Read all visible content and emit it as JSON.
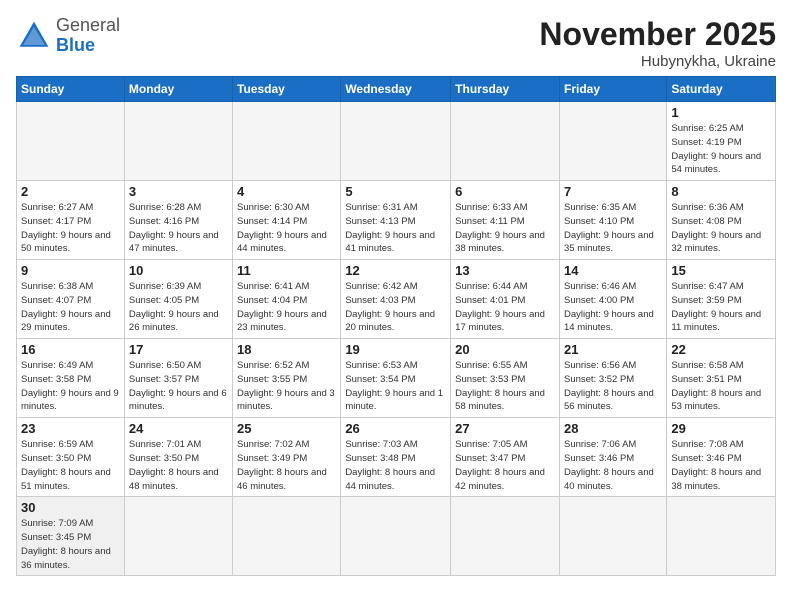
{
  "header": {
    "logo": {
      "general": "General",
      "blue": "Blue"
    },
    "title": "November 2025",
    "location": "Hubynykha, Ukraine"
  },
  "days_of_week": [
    "Sunday",
    "Monday",
    "Tuesday",
    "Wednesday",
    "Thursday",
    "Friday",
    "Saturday"
  ],
  "weeks": [
    [
      {
        "day": "",
        "info": ""
      },
      {
        "day": "",
        "info": ""
      },
      {
        "day": "",
        "info": ""
      },
      {
        "day": "",
        "info": ""
      },
      {
        "day": "",
        "info": ""
      },
      {
        "day": "",
        "info": ""
      },
      {
        "day": "1",
        "info": "Sunrise: 6:25 AM\nSunset: 4:19 PM\nDaylight: 9 hours\nand 54 minutes."
      }
    ],
    [
      {
        "day": "2",
        "info": "Sunrise: 6:27 AM\nSunset: 4:17 PM\nDaylight: 9 hours\nand 50 minutes."
      },
      {
        "day": "3",
        "info": "Sunrise: 6:28 AM\nSunset: 4:16 PM\nDaylight: 9 hours\nand 47 minutes."
      },
      {
        "day": "4",
        "info": "Sunrise: 6:30 AM\nSunset: 4:14 PM\nDaylight: 9 hours\nand 44 minutes."
      },
      {
        "day": "5",
        "info": "Sunrise: 6:31 AM\nSunset: 4:13 PM\nDaylight: 9 hours\nand 41 minutes."
      },
      {
        "day": "6",
        "info": "Sunrise: 6:33 AM\nSunset: 4:11 PM\nDaylight: 9 hours\nand 38 minutes."
      },
      {
        "day": "7",
        "info": "Sunrise: 6:35 AM\nSunset: 4:10 PM\nDaylight: 9 hours\nand 35 minutes."
      },
      {
        "day": "8",
        "info": "Sunrise: 6:36 AM\nSunset: 4:08 PM\nDaylight: 9 hours\nand 32 minutes."
      }
    ],
    [
      {
        "day": "9",
        "info": "Sunrise: 6:38 AM\nSunset: 4:07 PM\nDaylight: 9 hours\nand 29 minutes."
      },
      {
        "day": "10",
        "info": "Sunrise: 6:39 AM\nSunset: 4:05 PM\nDaylight: 9 hours\nand 26 minutes."
      },
      {
        "day": "11",
        "info": "Sunrise: 6:41 AM\nSunset: 4:04 PM\nDaylight: 9 hours\nand 23 minutes."
      },
      {
        "day": "12",
        "info": "Sunrise: 6:42 AM\nSunset: 4:03 PM\nDaylight: 9 hours\nand 20 minutes."
      },
      {
        "day": "13",
        "info": "Sunrise: 6:44 AM\nSunset: 4:01 PM\nDaylight: 9 hours\nand 17 minutes."
      },
      {
        "day": "14",
        "info": "Sunrise: 6:46 AM\nSunset: 4:00 PM\nDaylight: 9 hours\nand 14 minutes."
      },
      {
        "day": "15",
        "info": "Sunrise: 6:47 AM\nSunset: 3:59 PM\nDaylight: 9 hours\nand 11 minutes."
      }
    ],
    [
      {
        "day": "16",
        "info": "Sunrise: 6:49 AM\nSunset: 3:58 PM\nDaylight: 9 hours\nand 9 minutes."
      },
      {
        "day": "17",
        "info": "Sunrise: 6:50 AM\nSunset: 3:57 PM\nDaylight: 9 hours\nand 6 minutes."
      },
      {
        "day": "18",
        "info": "Sunrise: 6:52 AM\nSunset: 3:55 PM\nDaylight: 9 hours\nand 3 minutes."
      },
      {
        "day": "19",
        "info": "Sunrise: 6:53 AM\nSunset: 3:54 PM\nDaylight: 9 hours\nand 1 minute."
      },
      {
        "day": "20",
        "info": "Sunrise: 6:55 AM\nSunset: 3:53 PM\nDaylight: 8 hours\nand 58 minutes."
      },
      {
        "day": "21",
        "info": "Sunrise: 6:56 AM\nSunset: 3:52 PM\nDaylight: 8 hours\nand 56 minutes."
      },
      {
        "day": "22",
        "info": "Sunrise: 6:58 AM\nSunset: 3:51 PM\nDaylight: 8 hours\nand 53 minutes."
      }
    ],
    [
      {
        "day": "23",
        "info": "Sunrise: 6:59 AM\nSunset: 3:50 PM\nDaylight: 8 hours\nand 51 minutes."
      },
      {
        "day": "24",
        "info": "Sunrise: 7:01 AM\nSunset: 3:50 PM\nDaylight: 8 hours\nand 48 minutes."
      },
      {
        "day": "25",
        "info": "Sunrise: 7:02 AM\nSunset: 3:49 PM\nDaylight: 8 hours\nand 46 minutes."
      },
      {
        "day": "26",
        "info": "Sunrise: 7:03 AM\nSunset: 3:48 PM\nDaylight: 8 hours\nand 44 minutes."
      },
      {
        "day": "27",
        "info": "Sunrise: 7:05 AM\nSunset: 3:47 PM\nDaylight: 8 hours\nand 42 minutes."
      },
      {
        "day": "28",
        "info": "Sunrise: 7:06 AM\nSunset: 3:46 PM\nDaylight: 8 hours\nand 40 minutes."
      },
      {
        "day": "29",
        "info": "Sunrise: 7:08 AM\nSunset: 3:46 PM\nDaylight: 8 hours\nand 38 minutes."
      }
    ],
    [
      {
        "day": "30",
        "info": "Sunrise: 7:09 AM\nSunset: 3:45 PM\nDaylight: 8 hours\nand 36 minutes."
      },
      {
        "day": "",
        "info": ""
      },
      {
        "day": "",
        "info": ""
      },
      {
        "day": "",
        "info": ""
      },
      {
        "day": "",
        "info": ""
      },
      {
        "day": "",
        "info": ""
      },
      {
        "day": "",
        "info": ""
      }
    ]
  ]
}
